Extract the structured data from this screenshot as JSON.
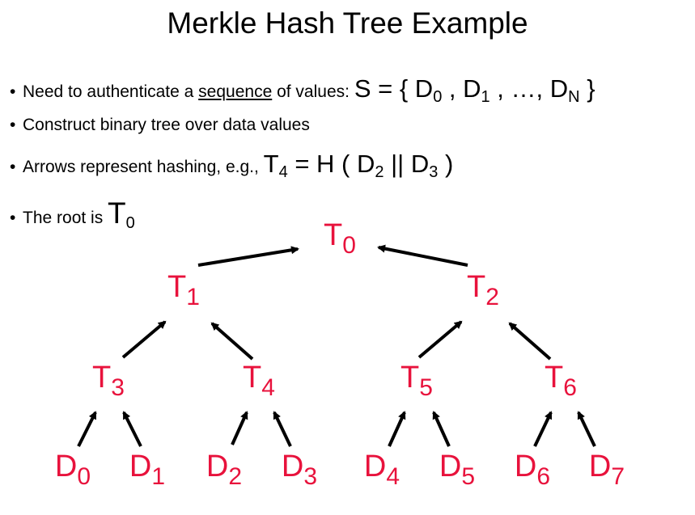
{
  "slide": {
    "title": "Merkle Hash Tree Example",
    "bullets": [
      {
        "pre": "Need to authenticate a ",
        "underlined": "sequence",
        "mid": " of values: ",
        "formula_set": "S",
        "formula_eq": " = { D",
        "s0": "0",
        "c1": " , D",
        "s1": "1",
        "c2": " , …, D",
        "sN": "N",
        "close": " }"
      },
      {
        "text": "Construct binary tree over data values"
      },
      {
        "pre": "Arrows represent hashing, e.g., ",
        "f1": "T",
        "s4": "4",
        "f2": " = H ( D",
        "s2": "2",
        "f3": " || D",
        "s3": "3",
        "f4": " )"
      },
      {
        "pre": "The root is ",
        "f": "T",
        "s0": "0"
      }
    ]
  },
  "tree": {
    "node_color": "#e8123c",
    "arrow_color": "#000000",
    "nodes": [
      {
        "id": "T0",
        "letter": "T",
        "sub": "0"
      },
      {
        "id": "T1",
        "letter": "T",
        "sub": "1"
      },
      {
        "id": "T2",
        "letter": "T",
        "sub": "2"
      },
      {
        "id": "T3",
        "letter": "T",
        "sub": "3"
      },
      {
        "id": "T4",
        "letter": "T",
        "sub": "4"
      },
      {
        "id": "T5",
        "letter": "T",
        "sub": "5"
      },
      {
        "id": "T6",
        "letter": "T",
        "sub": "6"
      },
      {
        "id": "D0",
        "letter": "D",
        "sub": "0"
      },
      {
        "id": "D1",
        "letter": "D",
        "sub": "1"
      },
      {
        "id": "D2",
        "letter": "D",
        "sub": "2"
      },
      {
        "id": "D3",
        "letter": "D",
        "sub": "3"
      },
      {
        "id": "D4",
        "letter": "D",
        "sub": "4"
      },
      {
        "id": "D5",
        "letter": "D",
        "sub": "5"
      },
      {
        "id": "D6",
        "letter": "D",
        "sub": "6"
      },
      {
        "id": "D7",
        "letter": "D",
        "sub": "7"
      }
    ],
    "edges": [
      [
        "T1",
        "T0"
      ],
      [
        "T2",
        "T0"
      ],
      [
        "T3",
        "T1"
      ],
      [
        "T4",
        "T1"
      ],
      [
        "T5",
        "T2"
      ],
      [
        "T6",
        "T2"
      ],
      [
        "D0",
        "T3"
      ],
      [
        "D1",
        "T3"
      ],
      [
        "D2",
        "T4"
      ],
      [
        "D3",
        "T4"
      ],
      [
        "D4",
        "T5"
      ],
      [
        "D5",
        "T5"
      ],
      [
        "D6",
        "T6"
      ],
      [
        "D7",
        "T6"
      ]
    ]
  }
}
